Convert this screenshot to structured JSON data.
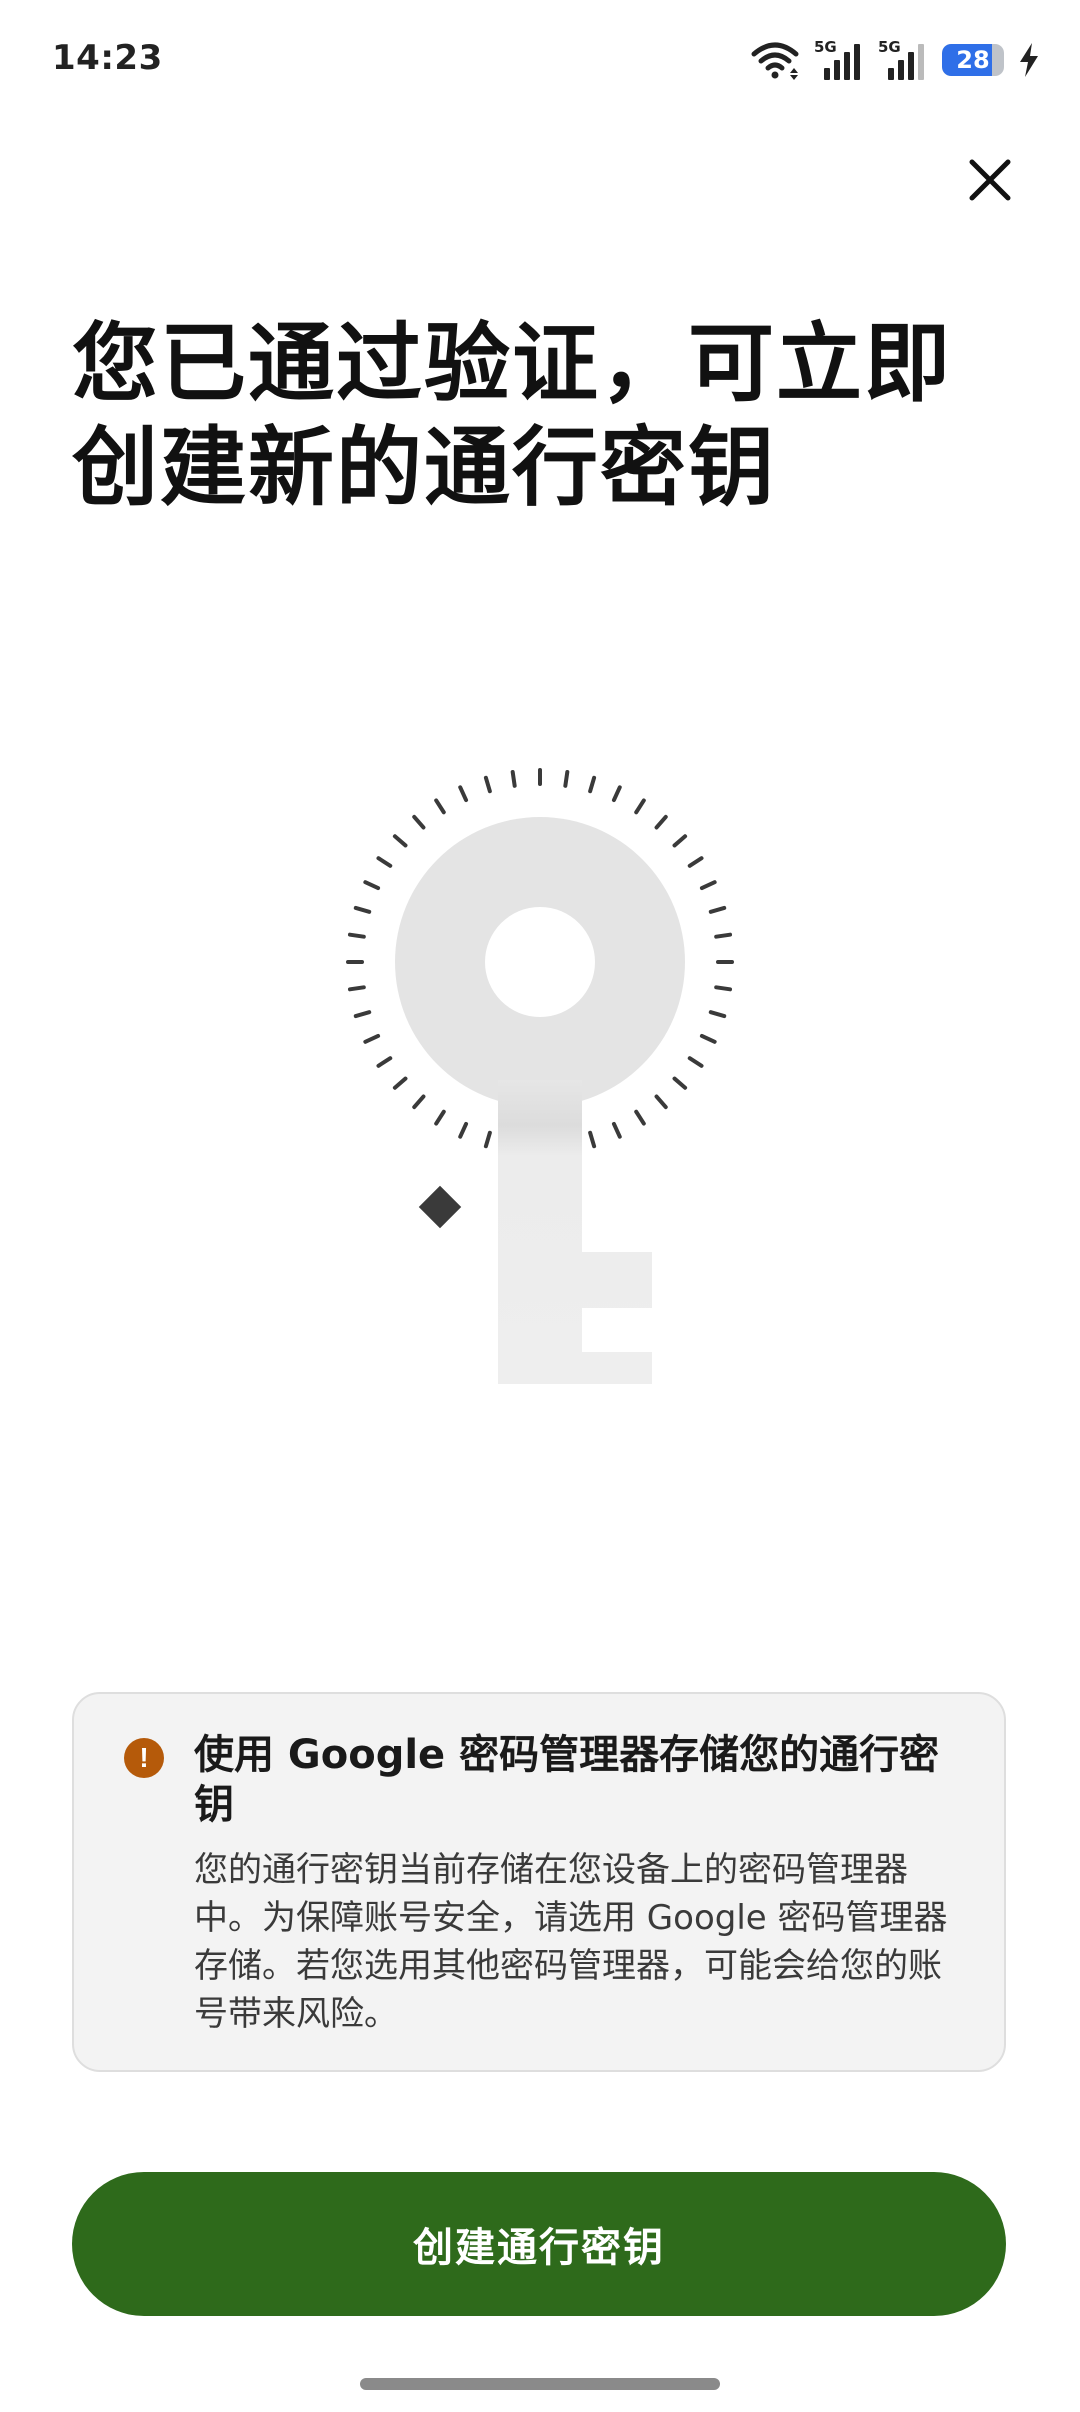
{
  "status_bar": {
    "time": "14:23",
    "network_left": "5G",
    "network_right": "5G",
    "battery": "28",
    "icons": [
      "wifi-icon",
      "signal-icon",
      "signal-icon",
      "battery-icon",
      "charging-bolt-icon"
    ],
    "battery_color": "#2f6fe8"
  },
  "header": {
    "close_icon": "close-icon"
  },
  "title": "您已通过验证，可立即创建新的通行密钥",
  "illustration": {
    "name": "passkey-key-illustration"
  },
  "notice": {
    "icon": "warning-icon",
    "icon_color": "#b55a0a",
    "title": "使用 Google 密码管理器存储您的通行密钥",
    "body": "您的通行密钥当前存储在您设备上的密码管理器中。为保障账号安全，请选用 Google 密码管理器存储。若您选用其他密码管理器，可能会给您的账号带来风险。"
  },
  "primary_button": {
    "label": "创建通行密钥",
    "color": "#2e6a1b"
  }
}
